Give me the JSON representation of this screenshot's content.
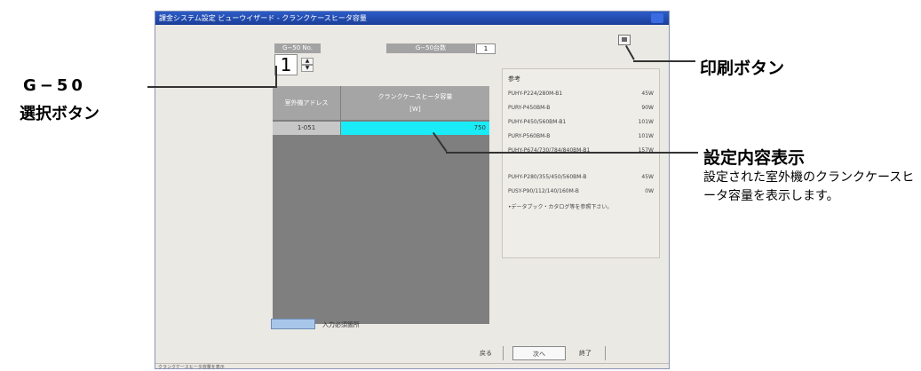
{
  "window": {
    "title": "課金システム設定 ビューウイザード - クランクケースヒータ容量",
    "status_bar": "クランクケースヒータ容量を表示"
  },
  "g50_selector": {
    "no_label": "G−50 No.",
    "no_value": "1",
    "count_label": "G−50台数",
    "count_value": "1"
  },
  "table": {
    "headers": [
      "室外機アドレス",
      "クランクケースヒータ容量",
      "[W]"
    ],
    "rows": [
      {
        "address": "1-051",
        "capacity": "750"
      }
    ]
  },
  "reference": {
    "title": "参考",
    "items": [
      {
        "model": "PUHY-P224/280M-B1",
        "value": "45W"
      },
      {
        "model": "PURY-P450BM-B",
        "value": "90W"
      },
      {
        "model": "PUHY-P450/560BM-B1",
        "value": "101W"
      },
      {
        "model": "PURY-P560BM-B",
        "value": "101W"
      },
      {
        "model": "PUHY-P674/730/784/840BM-B1",
        "value": "157W"
      },
      {
        "model": "PUHY-P280/355/450/560BM-B",
        "value": "45W"
      },
      {
        "model": "PUSY-P90/112/140/160M-B",
        "value": "0W"
      }
    ],
    "note": "•データブック・カタログ等を参照下さい。"
  },
  "legend": {
    "label": "入力必須箇所"
  },
  "buttons": {
    "back": "戻る",
    "next": "次へ",
    "end": "終了"
  },
  "callouts": {
    "g50_line1": "G−50",
    "g50_line2": "選択ボタン",
    "print": "印刷ボタン",
    "display_title": "設定内容表示",
    "display_desc": "設定された室外機のクランクケースヒータ容量を表示します。"
  },
  "colors": {
    "titlebar": "#1b3e98",
    "window_bg": "#ebe9e4",
    "table_bg": "#7f7f7f",
    "header_gray": "#a5a5a5",
    "capacity_cell": "#19ecf7",
    "legend_swatch": "#a8c6ea"
  },
  "icons": {
    "print": "printer-icon",
    "spin_up": "spin-up-icon",
    "spin_down": "spin-down-icon"
  }
}
